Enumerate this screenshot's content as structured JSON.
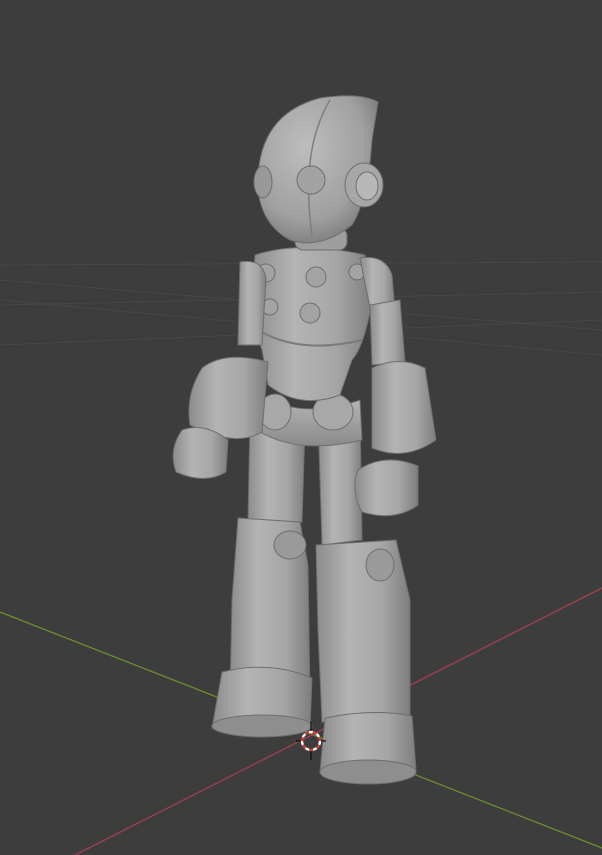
{
  "viewport": {
    "background": "#3d3d3d",
    "grid_color": "#474747",
    "x_axis_color": "#a0414c",
    "y_axis_color": "#6c8e2f"
  },
  "scene": {
    "object": "robot-figure",
    "shading": "solid",
    "model_color": "#a9a9a9"
  },
  "cursor_3d": {
    "icon": "3d-cursor-icon",
    "ring_colors": [
      "#d53b3b",
      "#ffffff"
    ]
  }
}
